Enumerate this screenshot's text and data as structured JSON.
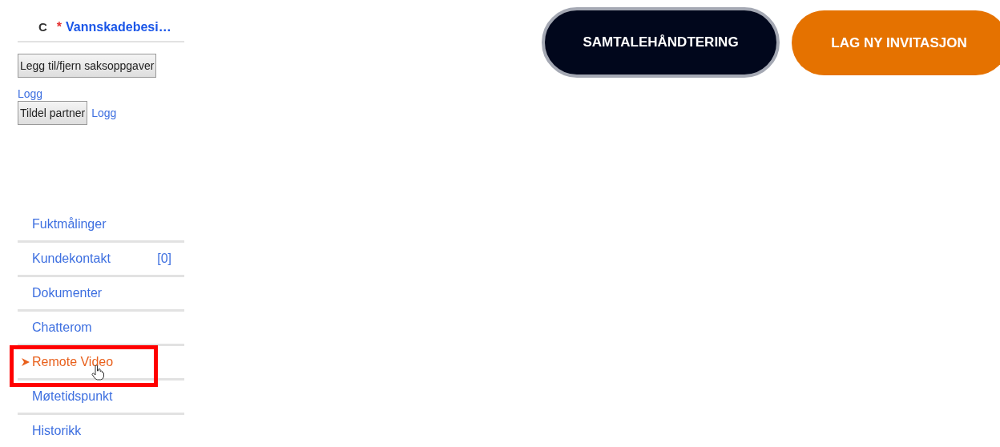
{
  "case_header": {
    "prefix": "C",
    "required_mark": "*",
    "title": "Vannskadebesi…"
  },
  "task_button": "Legg til/fjern saksoppgaver",
  "task_log_link": "Logg",
  "partner_button": "Tildel partner",
  "partner_log_link": "Logg",
  "menu_items": [
    {
      "label": "Fuktmålinger",
      "selected": false
    },
    {
      "label": "Kundekontakt",
      "count": "[0]",
      "selected": false
    },
    {
      "label": "Dokumenter",
      "selected": false
    },
    {
      "label": "Chatterom",
      "selected": false
    },
    {
      "label": "Remote Video",
      "selected": true,
      "highlighted": true
    },
    {
      "label": "Møtetidspunkt",
      "selected": false
    },
    {
      "label": "Historikk",
      "selected": false
    }
  ],
  "action_buttons": [
    {
      "label": "SAMTALEHÅNDTERING",
      "kind": "dark"
    },
    {
      "label": "LAG NY INVITASJON",
      "kind": "orange"
    }
  ]
}
